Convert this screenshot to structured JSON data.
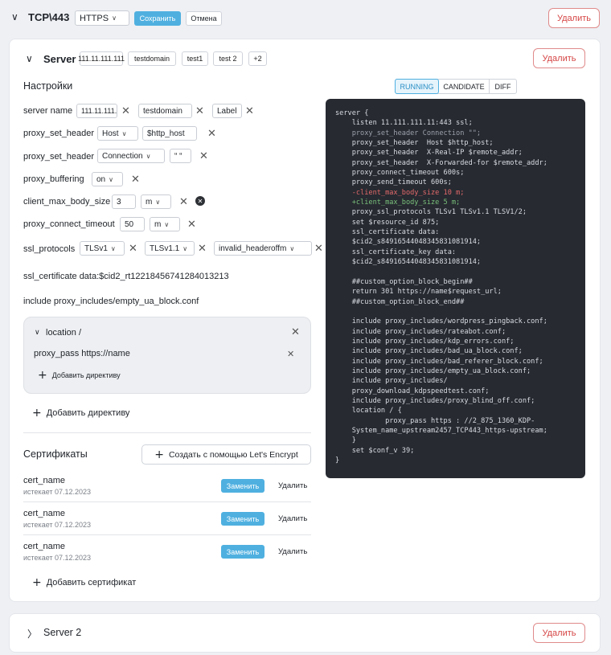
{
  "header": {
    "title": "TCP\\443",
    "protocol": "HTTPS",
    "save_label": "Сохранить",
    "cancel_label": "Отмена",
    "delete_label": "Удалить"
  },
  "server": {
    "title": "Server",
    "tags": [
      "111.11.111.111",
      "testdomain",
      "test1",
      "test 2",
      "+2"
    ],
    "delete_label": "Удалить",
    "settings_title": "Настройки",
    "view_tabs": [
      "RUNNING",
      "CANDIDATE",
      "DIFF"
    ],
    "active_tab": "RUNNING",
    "directives": {
      "server_name": {
        "label": "server name",
        "values": [
          "111.11.111.111",
          "testdomain",
          "Label"
        ]
      },
      "proxy_set_header_1": {
        "label": "proxy_set_header",
        "key": "Host",
        "value": "$http_host"
      },
      "proxy_set_header_2": {
        "label": "proxy_set_header",
        "key": "Connection",
        "value": "“ “"
      },
      "proxy_buffering": {
        "label": "proxy_buffering",
        "value": "on"
      },
      "client_max_body_size": {
        "label": "client_max_body_size",
        "value": "3",
        "unit": "m"
      },
      "proxy_connect_timeout": {
        "label": "proxy_connect_timeout",
        "value": "50",
        "unit": "m"
      },
      "ssl_protocols": {
        "label": "ssl_protocols",
        "values": [
          "TLSv1",
          "TLSv1.1",
          "invalid_headeroffm"
        ]
      },
      "ssl_certificate": {
        "text": "ssl_certificate   data:$cid2_rt12218456741284013213"
      },
      "include": {
        "text": "include proxy_includes/empty_ua_block.conf"
      }
    },
    "location": {
      "title": "location /",
      "proxy_pass": "proxy_pass https://name",
      "add_directive_label": "Добавить  директиву"
    },
    "add_directive_label": "Добавить  директиву",
    "certs_title": "Сертификаты",
    "create_lets_encrypt": "Создать с помощью Let's Encrypt",
    "certs": [
      {
        "name": "cert_name",
        "expires": "истекает 07.12.2023"
      },
      {
        "name": "cert_name",
        "expires": "истекает 07.12.2023"
      },
      {
        "name": "cert_name",
        "expires": "истекает 07.12.2023"
      }
    ],
    "replace_label": "Заменить",
    "remove_label": "Удалить",
    "add_cert_label": "Добавить  сертификат"
  },
  "code_lines": [
    {
      "t": "server {",
      "c": ""
    },
    {
      "t": "    listen 11.111.111.11:443 ssl;",
      "c": ""
    },
    {
      "t": "    proxy_set_header Connection \"\";",
      "c": "dim"
    },
    {
      "t": "    proxy_set_header  Host $http_host;",
      "c": ""
    },
    {
      "t": "    proxy_set_header  X-Real-IP $remote_addr;",
      "c": ""
    },
    {
      "t": "    proxy_set_header  X-Forwarded-for $remote_addr;",
      "c": ""
    },
    {
      "t": "    proxy_connect_timeout 600s;",
      "c": ""
    },
    {
      "t": "    proxy_send_timeout 600s;",
      "c": ""
    },
    {
      "t": "    -client_max_body_size 10 m;",
      "c": "del"
    },
    {
      "t": "    +client_max_body_size 5 m;",
      "c": "add"
    },
    {
      "t": "    proxy_ssl_protocols TLSv1 TLSv1.1 TLSV1/2;",
      "c": ""
    },
    {
      "t": "    set $resource_id 875;",
      "c": ""
    },
    {
      "t": "    ssl_certificate data:",
      "c": ""
    },
    {
      "t": "    $cid2_s84916544048345831081914;",
      "c": ""
    },
    {
      "t": "    ssl_certificate_key data:",
      "c": ""
    },
    {
      "t": "    $cid2_s84916544048345831081914;",
      "c": ""
    },
    {
      "t": "",
      "c": ""
    },
    {
      "t": "    ##custom_option_block_begin##",
      "c": ""
    },
    {
      "t": "    return 301 https://name$request_url;",
      "c": ""
    },
    {
      "t": "    ##custom_option_block_end##",
      "c": ""
    },
    {
      "t": "",
      "c": ""
    },
    {
      "t": "    include proxy_includes/wordpress_pingback.conf;",
      "c": ""
    },
    {
      "t": "    include proxy_includes/rateabot.conf;",
      "c": ""
    },
    {
      "t": "    include proxy_includes/kdp_errors.conf;",
      "c": ""
    },
    {
      "t": "    include proxy_includes/bad_ua_block.conf;",
      "c": ""
    },
    {
      "t": "    include proxy_includes/bad_referer_block.conf;",
      "c": ""
    },
    {
      "t": "    include proxy_includes/empty_ua_block.conf;",
      "c": ""
    },
    {
      "t": "    include proxy_includes/",
      "c": ""
    },
    {
      "t": "    proxy_download_kdpspeedtest.conf;",
      "c": ""
    },
    {
      "t": "    include proxy_includes/proxy_blind_off.conf;",
      "c": ""
    },
    {
      "t": "    location / {",
      "c": ""
    },
    {
      "t": "            proxy_pass https : //2_875_1360_KDP-",
      "c": ""
    },
    {
      "t": "    System_name_upstream2457_TCP443_https-upstream;",
      "c": ""
    },
    {
      "t": "    }",
      "c": ""
    },
    {
      "t": "    set $conf_v 39;",
      "c": ""
    },
    {
      "t": "}",
      "c": ""
    }
  ],
  "server2": {
    "title": "Server 2",
    "delete_label": "Удалить"
  }
}
